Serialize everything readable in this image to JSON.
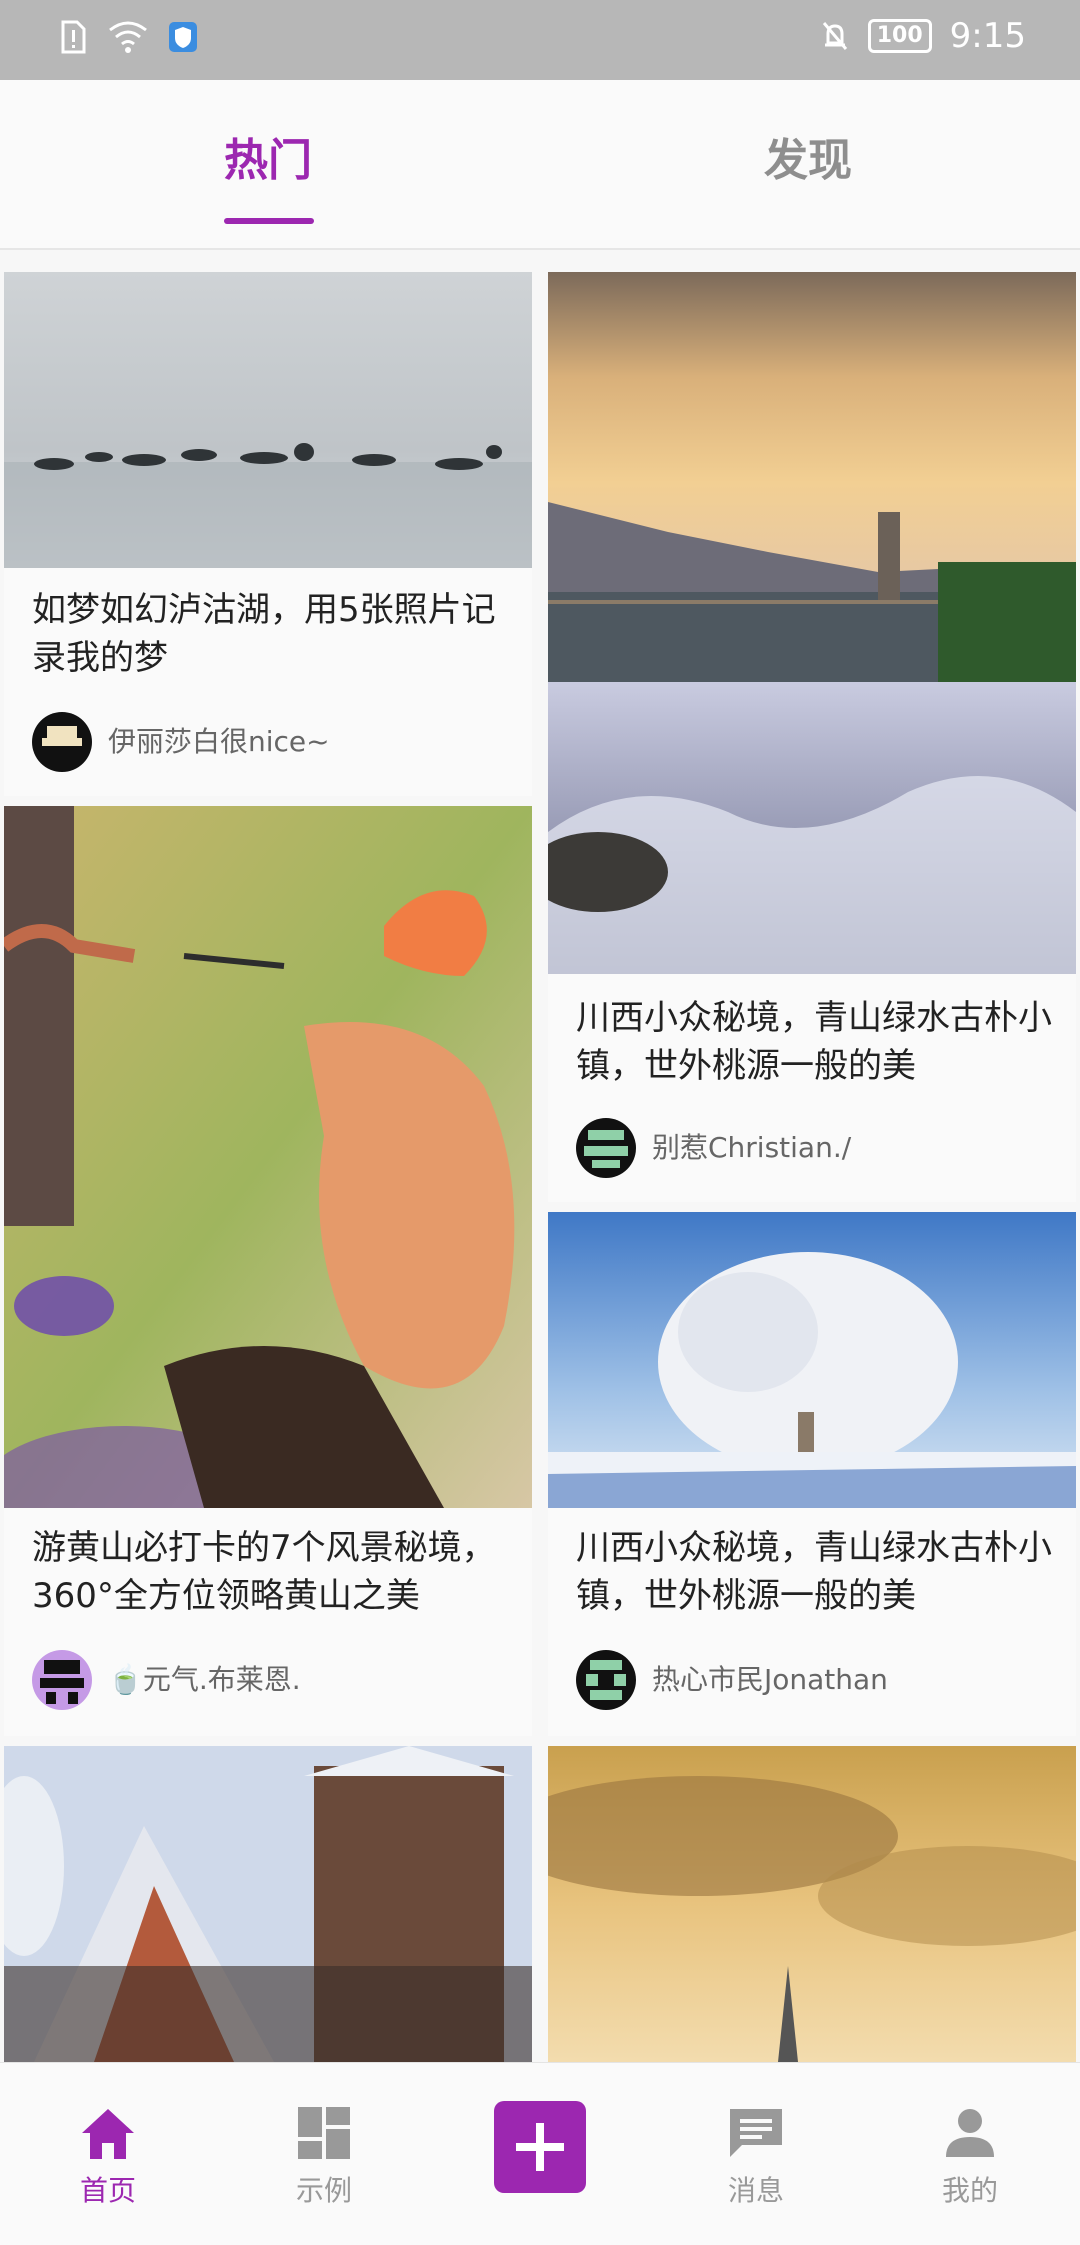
{
  "status_bar": {
    "time": "9:15",
    "battery": "100"
  },
  "tabs": [
    {
      "label": "热门",
      "active": true
    },
    {
      "label": "发现",
      "active": false
    }
  ],
  "cards": [
    {
      "title": "如梦如幻泸沽湖，用5张照片记录我的梦",
      "author": "伊丽莎白很nice~"
    },
    {
      "title": "川西小众秘境，青山绿水古朴小镇，世外桃源一般的美",
      "author": "别惹Christian./"
    },
    {
      "title": "游黄山必打卡的7个风景秘境，360°全方位领略黄山之美",
      "author": "🍵元气.布莱恩."
    },
    {
      "title": "川西小众秘境，青山绿水古朴小镇，世外桃源一般的美",
      "author": "热心市民Jonathan"
    }
  ],
  "bottom_nav": [
    {
      "label": "首页",
      "icon": "home-icon",
      "active": true
    },
    {
      "label": "示例",
      "icon": "dashboard-icon",
      "active": false
    },
    {
      "label": "",
      "icon": "add-icon",
      "active": false
    },
    {
      "label": "消息",
      "icon": "message-icon",
      "active": false
    },
    {
      "label": "我的",
      "icon": "person-icon",
      "active": false
    }
  ],
  "colors": {
    "accent": "#9c27b0",
    "status_bar": "#b7b7b7"
  }
}
